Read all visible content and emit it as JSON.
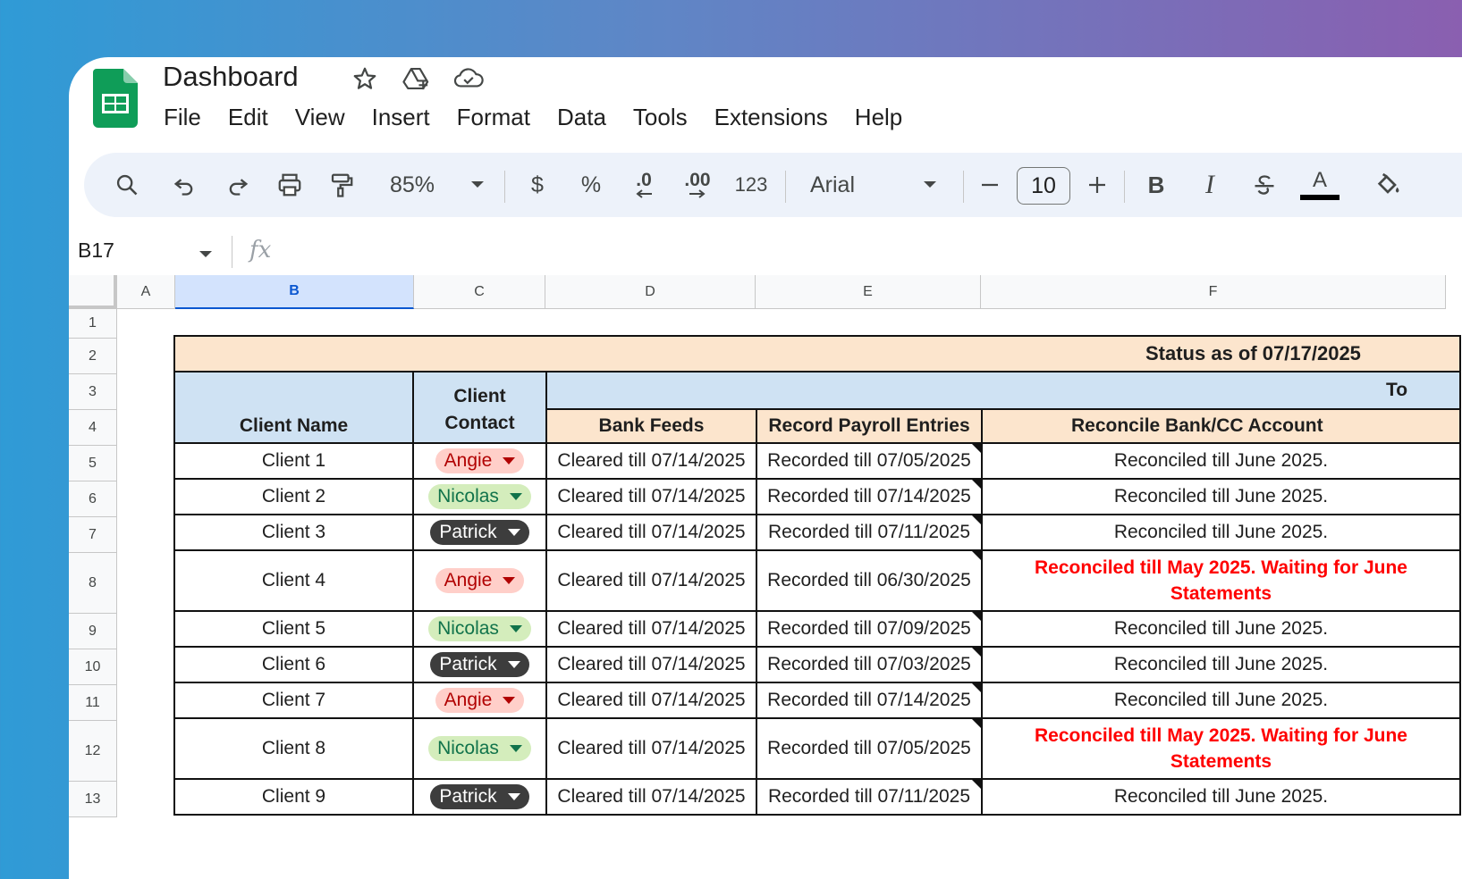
{
  "app": {
    "doc_title": "Dashboard",
    "menu": [
      "File",
      "Edit",
      "View",
      "Insert",
      "Format",
      "Data",
      "Tools",
      "Extensions",
      "Help"
    ]
  },
  "toolbar": {
    "zoom": "85%",
    "currency": "$",
    "percent": "%",
    "dec_decrease": ".0",
    "dec_increase": ".00",
    "number_format": "123",
    "font": "Arial",
    "font_size": "10",
    "bold": "B",
    "italic": "I",
    "text_color_letter": "A"
  },
  "formula_bar": {
    "cell_ref": "B17",
    "fx": "fx"
  },
  "columns": [
    "A",
    "B",
    "C",
    "D",
    "E",
    "F"
  ],
  "rows": [
    "1",
    "2",
    "3",
    "4",
    "5",
    "6",
    "7",
    "8",
    "9",
    "10",
    "11",
    "12",
    "13"
  ],
  "sheet": {
    "status_title": "Status as of 07/17/2025",
    "group_header_partial": "To",
    "headers": {
      "client_name": "Client Name",
      "client_contact_1": "Client",
      "client_contact_2": "Contact",
      "bank_feeds": "Bank Feeds",
      "payroll": "Record Payroll Entries",
      "reconcile": "Reconcile Bank/CC Account"
    },
    "records": [
      {
        "client": "Client 1",
        "contact": "Angie",
        "bank": "Cleared till 07/14/2025",
        "payroll": "Recorded till 07/05/2025",
        "reconcile": "Reconciled till June 2025.",
        "reconcile2": "",
        "alert": false
      },
      {
        "client": "Client 2",
        "contact": "Nicolas",
        "bank": "Cleared till 07/14/2025",
        "payroll": "Recorded till 07/14/2025",
        "reconcile": "Reconciled till June 2025.",
        "reconcile2": "",
        "alert": false
      },
      {
        "client": "Client 3",
        "contact": "Patrick",
        "bank": "Cleared till 07/14/2025",
        "payroll": "Recorded till 07/11/2025",
        "reconcile": "Reconciled till June 2025.",
        "reconcile2": "",
        "alert": false
      },
      {
        "client": "Client 4",
        "contact": "Angie",
        "bank": "Cleared till 07/14/2025",
        "payroll": "Recorded till 06/30/2025",
        "reconcile": "Reconciled till May 2025. Waiting for June",
        "reconcile2": "Statements",
        "alert": true
      },
      {
        "client": "Client 5",
        "contact": "Nicolas",
        "bank": "Cleared till 07/14/2025",
        "payroll": "Recorded till 07/09/2025",
        "reconcile": "Reconciled till June 2025.",
        "reconcile2": "",
        "alert": false
      },
      {
        "client": "Client 6",
        "contact": "Patrick",
        "bank": "Cleared till 07/14/2025",
        "payroll": "Recorded till 07/03/2025",
        "reconcile": "Reconciled till June 2025.",
        "reconcile2": "",
        "alert": false
      },
      {
        "client": "Client 7",
        "contact": "Angie",
        "bank": "Cleared till 07/14/2025",
        "payroll": "Recorded till 07/14/2025",
        "reconcile": "Reconciled till June 2025.",
        "reconcile2": "",
        "alert": false
      },
      {
        "client": "Client 8",
        "contact": "Nicolas",
        "bank": "Cleared till 07/14/2025",
        "payroll": "Recorded till 07/05/2025",
        "reconcile": "Reconciled till May 2025. Waiting for June",
        "reconcile2": "Statements",
        "alert": true
      },
      {
        "client": "Client 9",
        "contact": "Patrick",
        "bank": "Cleared till 07/14/2025",
        "payroll": "Recorded till 07/11/2025",
        "reconcile": "Reconciled till June 2025.",
        "reconcile2": "",
        "alert": false
      }
    ]
  },
  "colors": {
    "angie_chip": "#ffcfc9",
    "nicolas_chip": "#d4edbc",
    "patrick_chip": "#3d3d3d",
    "header_blue": "#cfe2f3",
    "header_peach": "#fce5cd",
    "alert_red": "#ff0000"
  }
}
